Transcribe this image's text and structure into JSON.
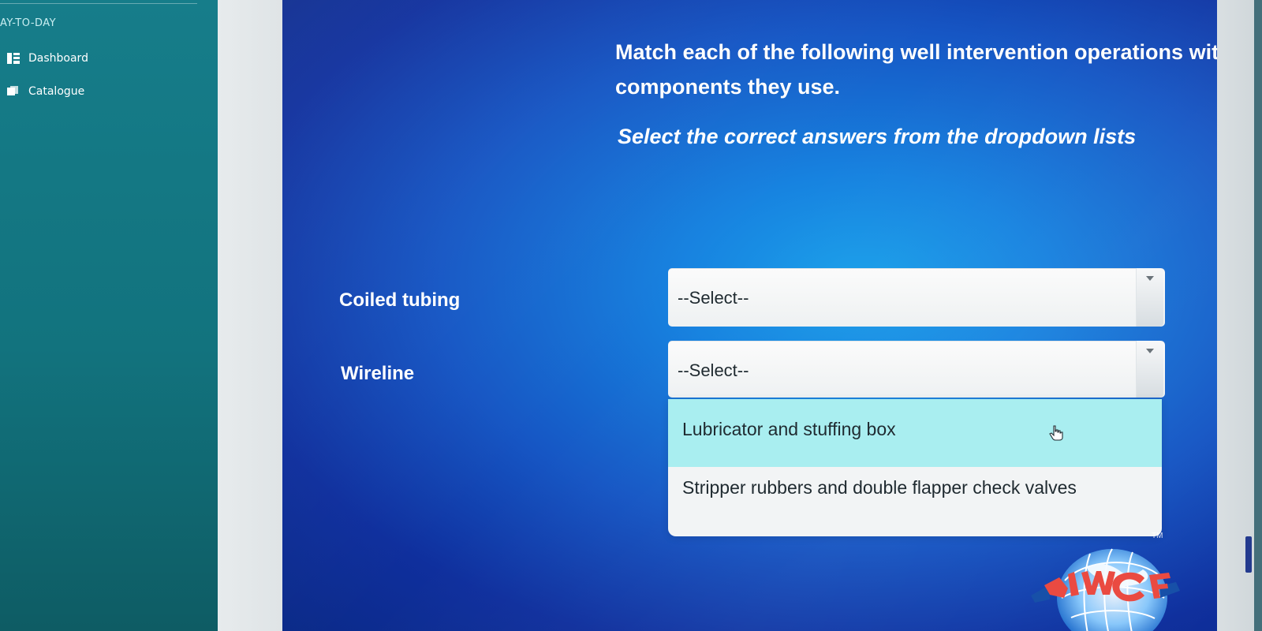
{
  "sidebar": {
    "heading": "AY-TO-DAY",
    "items": [
      {
        "label": "Dashboard",
        "icon": "dashboard-icon"
      },
      {
        "label": "Catalogue",
        "icon": "catalogue-icon"
      }
    ]
  },
  "question": {
    "prompt": "Match each of the following well intervention operations with the primary barrier components they use.",
    "instruction": "Select the correct answers from the dropdown lists"
  },
  "matches": [
    {
      "label": "Coiled tubing",
      "select_value": "--Select--"
    },
    {
      "label": "Wireline",
      "select_value": "--Select--"
    }
  ],
  "dropdown": {
    "open_for": "Wireline",
    "options": [
      "Lubricator and stuffing box",
      "Stripper rubbers and double flapper check valves"
    ],
    "highlighted_index": 0
  },
  "branding": {
    "logo_text": "IWCF",
    "logo_mark": "TM"
  },
  "colors": {
    "sidebar": "#167d8a",
    "content_center": "#1aa0ea",
    "content_edge": "#0b2a88",
    "option_highlight": "#a9eef0",
    "logo_red": "#ea4a41"
  }
}
